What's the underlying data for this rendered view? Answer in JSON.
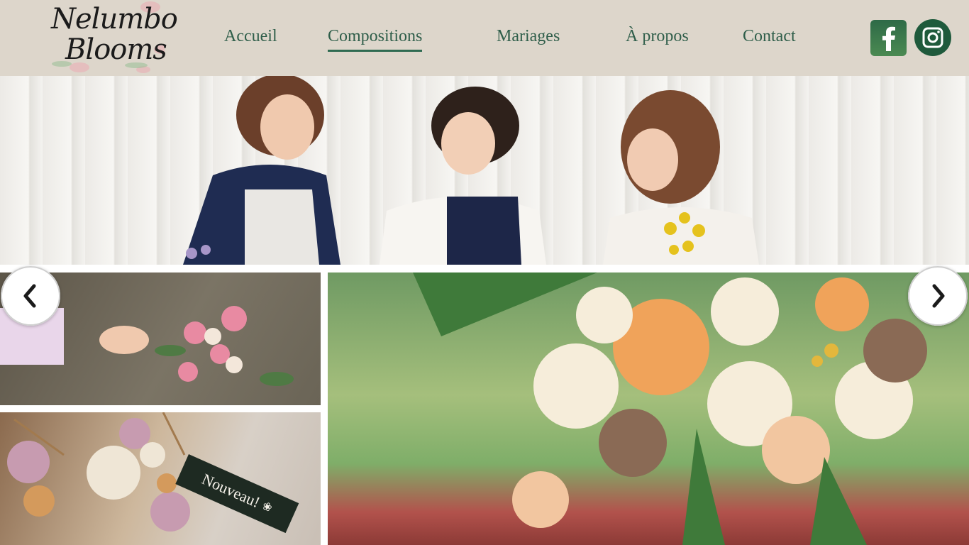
{
  "brand": {
    "line1": "Nelumbo",
    "line2": "Blooms"
  },
  "nav": {
    "items": [
      {
        "label": "Accueil",
        "active": false
      },
      {
        "label": "Compositions",
        "active": true
      },
      {
        "label": "Mariages",
        "active": false
      },
      {
        "label": "À propos",
        "active": false
      },
      {
        "label": "Contact",
        "active": false
      }
    ]
  },
  "social": {
    "facebook_icon": "facebook-icon",
    "instagram_icon": "instagram-icon"
  },
  "gallery": {
    "badge": "Nouveau!"
  },
  "carousel": {
    "prev_icon": "chevron-left-icon",
    "next_icon": "chevron-right-icon"
  },
  "colors": {
    "header_bg": "#ddd6cb",
    "nav_text": "#2f5e4a",
    "accent": "#2f6b52",
    "social_green": "#1f5a3c",
    "badge_bg": "#1e2a22"
  }
}
